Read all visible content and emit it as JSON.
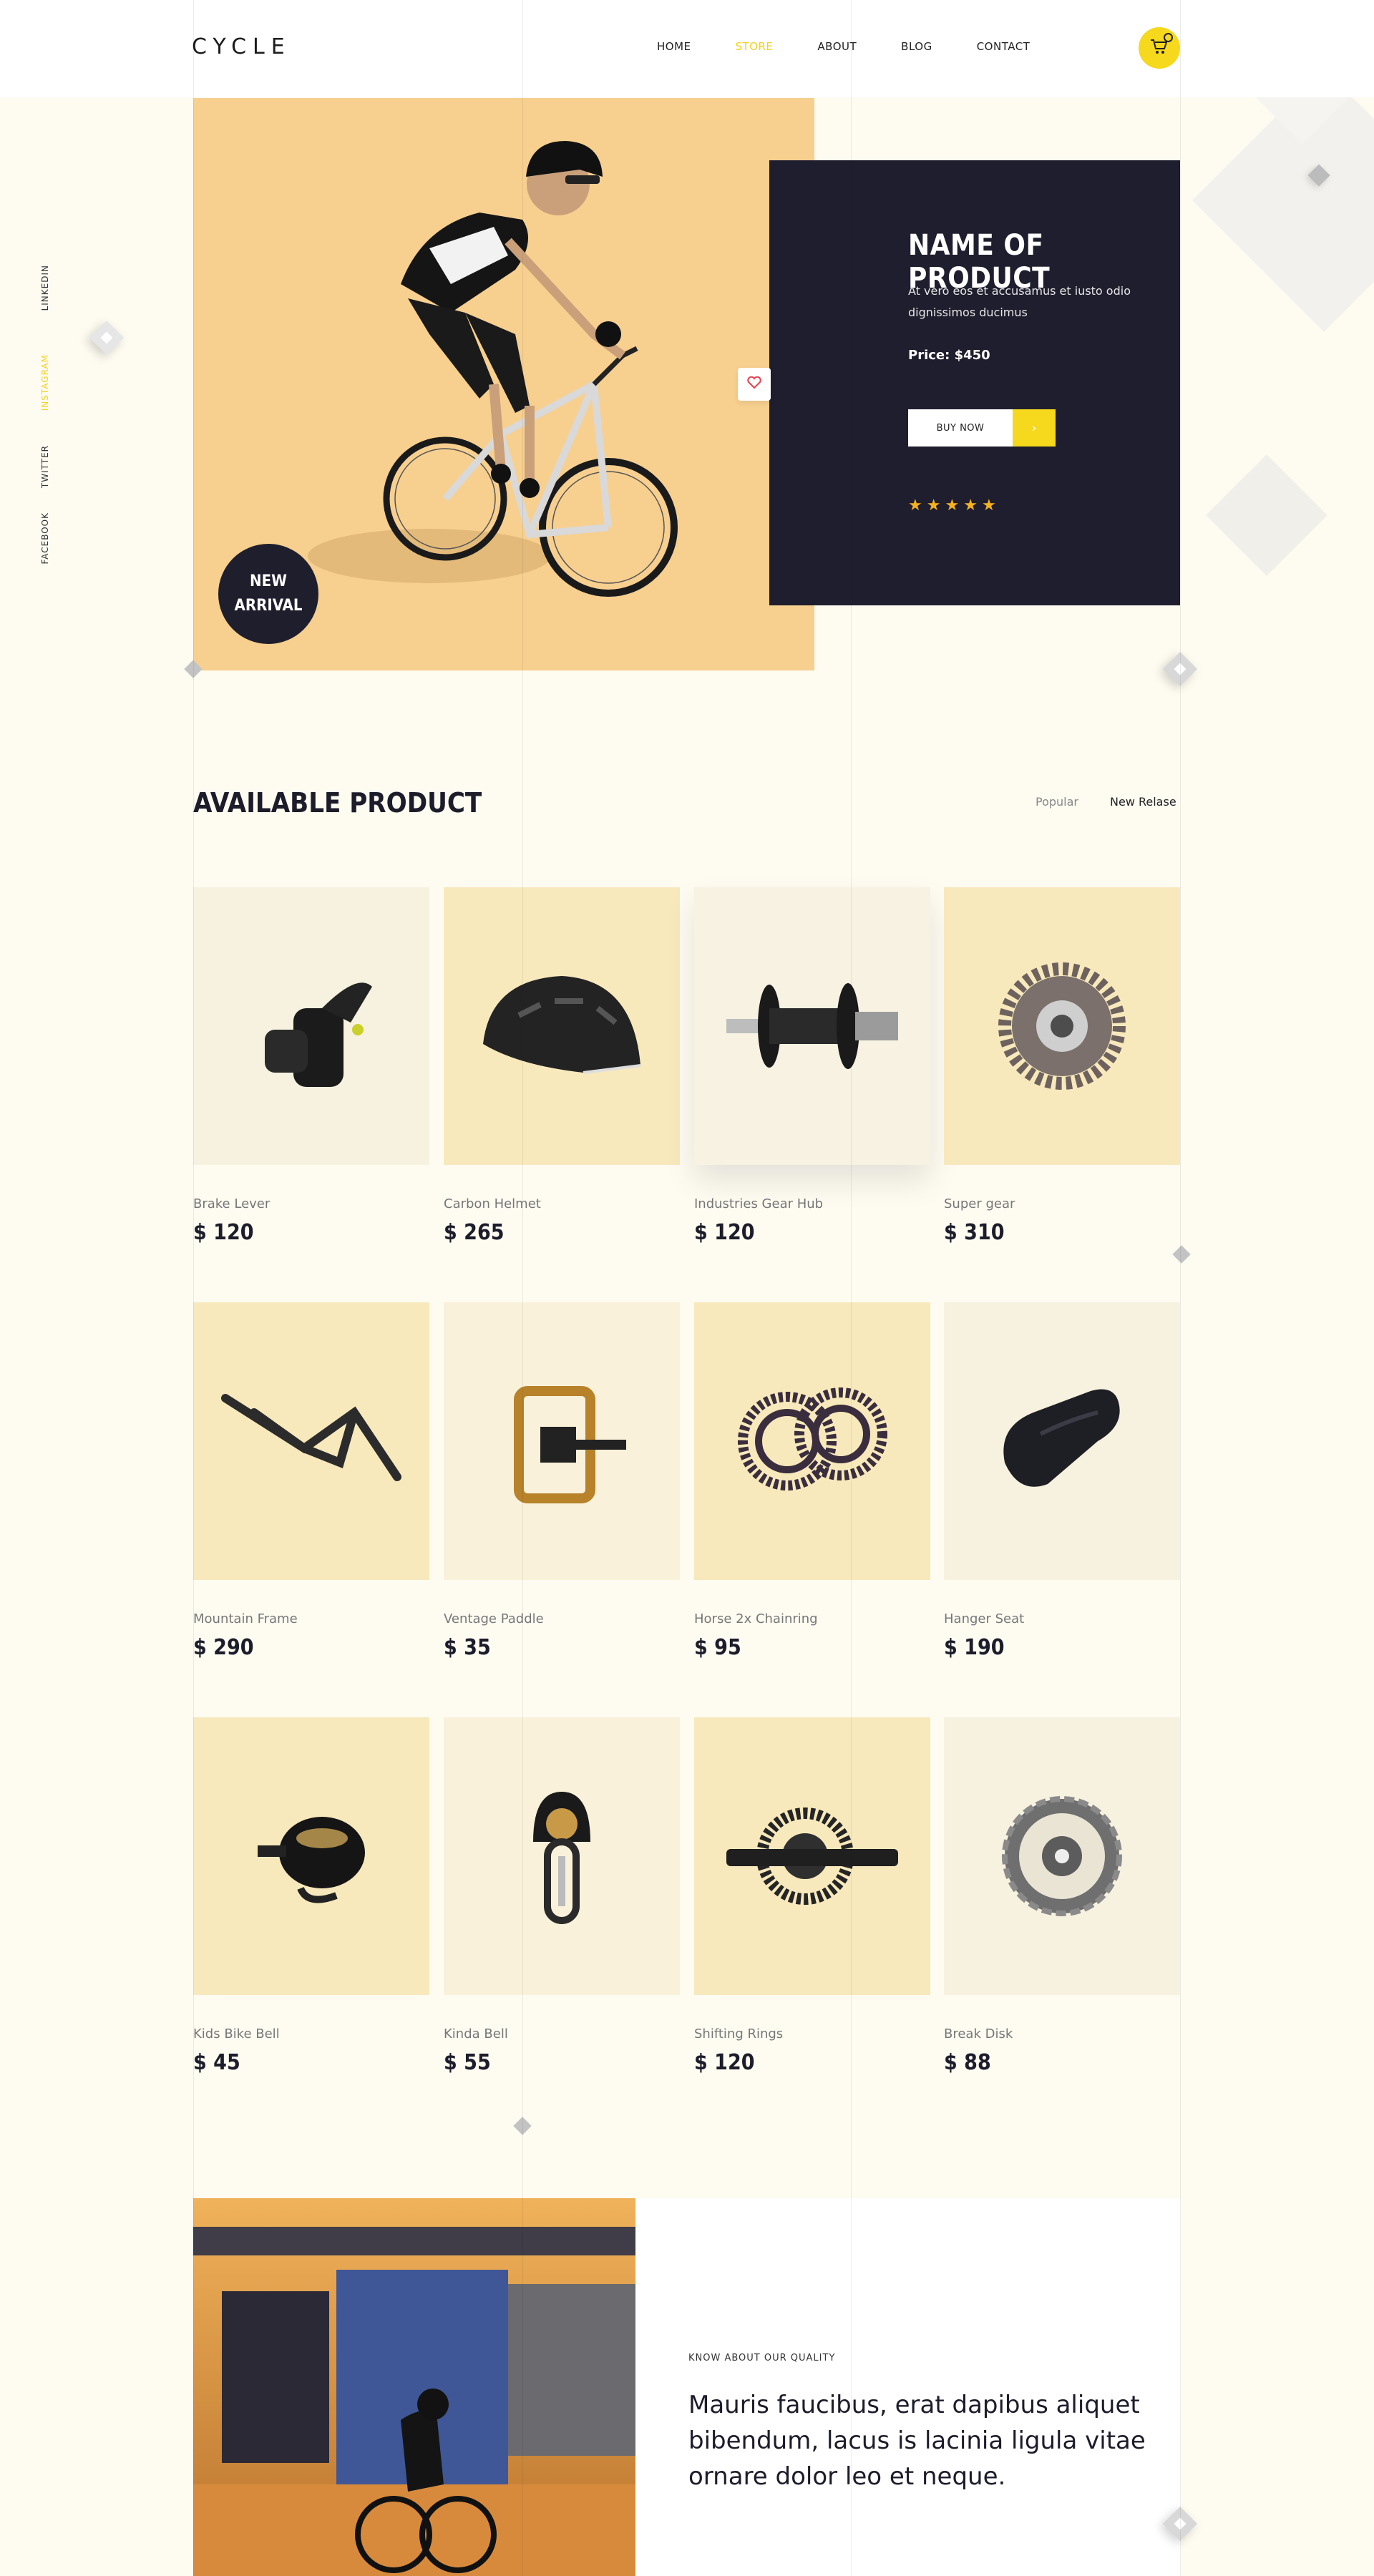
{
  "header": {
    "logo": "CYCLE",
    "nav": [
      {
        "label": "HOME",
        "active": false
      },
      {
        "label": "STORE",
        "active": true
      },
      {
        "label": "ABOUT",
        "active": false
      },
      {
        "label": "BLOG",
        "active": false
      },
      {
        "label": "CONTACT",
        "active": false
      }
    ],
    "cart_icon": "cart-icon"
  },
  "social": [
    "LINKEDIN",
    "INSTAGRAM",
    "TWITTER",
    "FACEBOOK"
  ],
  "social_active": "INSTAGRAM",
  "hero": {
    "badge_line1": "NEW",
    "badge_line2": "ARRIVAL",
    "product_title": "NAME OF PRODUCT",
    "product_desc": "At vero eos et accusamus et iusto odio dignissimos ducimus",
    "price": "Price: $450",
    "buy_label": "BUY NOW",
    "rating": 5
  },
  "products_section": {
    "title": "AVAILABLE PRODUCT",
    "filters": [
      "Popular",
      "New Relase"
    ],
    "items": [
      {
        "name": "Brake Lever",
        "price": "$ 120"
      },
      {
        "name": "Carbon Helmet",
        "price": "$ 265"
      },
      {
        "name": "Industries Gear Hub",
        "price": "$ 120"
      },
      {
        "name": "Super gear",
        "price": "$ 310"
      },
      {
        "name": "Mountain Frame",
        "price": "$ 290"
      },
      {
        "name": "Ventage Paddle",
        "price": "$ 35"
      },
      {
        "name": "Horse 2x Chainring",
        "price": "$ 95"
      },
      {
        "name": "Hanger Seat",
        "price": "$ 190"
      },
      {
        "name": "Kids Bike Bell",
        "price": "$ 45"
      },
      {
        "name": "Kinda Bell",
        "price": "$ 55"
      },
      {
        "name": "Shifting Rings",
        "price": "$ 120"
      },
      {
        "name": "Break Disk",
        "price": "$ 88"
      }
    ]
  },
  "about": {
    "kicker": "KNOW ABOUT OUR QUALITY",
    "text": "Mauris faucibus, erat dapibus aliquet bibendum, lacus is lacinia ligula vitae ornare dolor leo et neque."
  },
  "colors": {
    "accent": "#f6d81c",
    "dark": "#1f1e2e",
    "cream": "#fefbf1"
  }
}
